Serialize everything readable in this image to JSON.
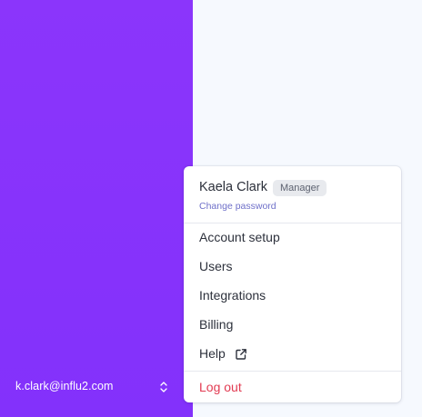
{
  "sidebar": {
    "user_email": "k.clark@influ2.com"
  },
  "user_menu": {
    "name": "Kaela Clark",
    "role": "Manager",
    "change_password": "Change password",
    "items": [
      {
        "label": "Account setup"
      },
      {
        "label": "Users"
      },
      {
        "label": "Integrations"
      },
      {
        "label": "Billing"
      },
      {
        "label": "Help",
        "icon": "external-link-icon"
      }
    ],
    "logout": "Log out"
  },
  "colors": {
    "sidebar_background": "#8b35fb",
    "main_background": "#f6f9fe",
    "link_color": "#6f70c9",
    "logout_color": "#e23b52",
    "text_color": "#2d313c"
  },
  "icons": {
    "sidebar_toggle": "chevron-up-down-icon",
    "help": "external-link-icon"
  }
}
